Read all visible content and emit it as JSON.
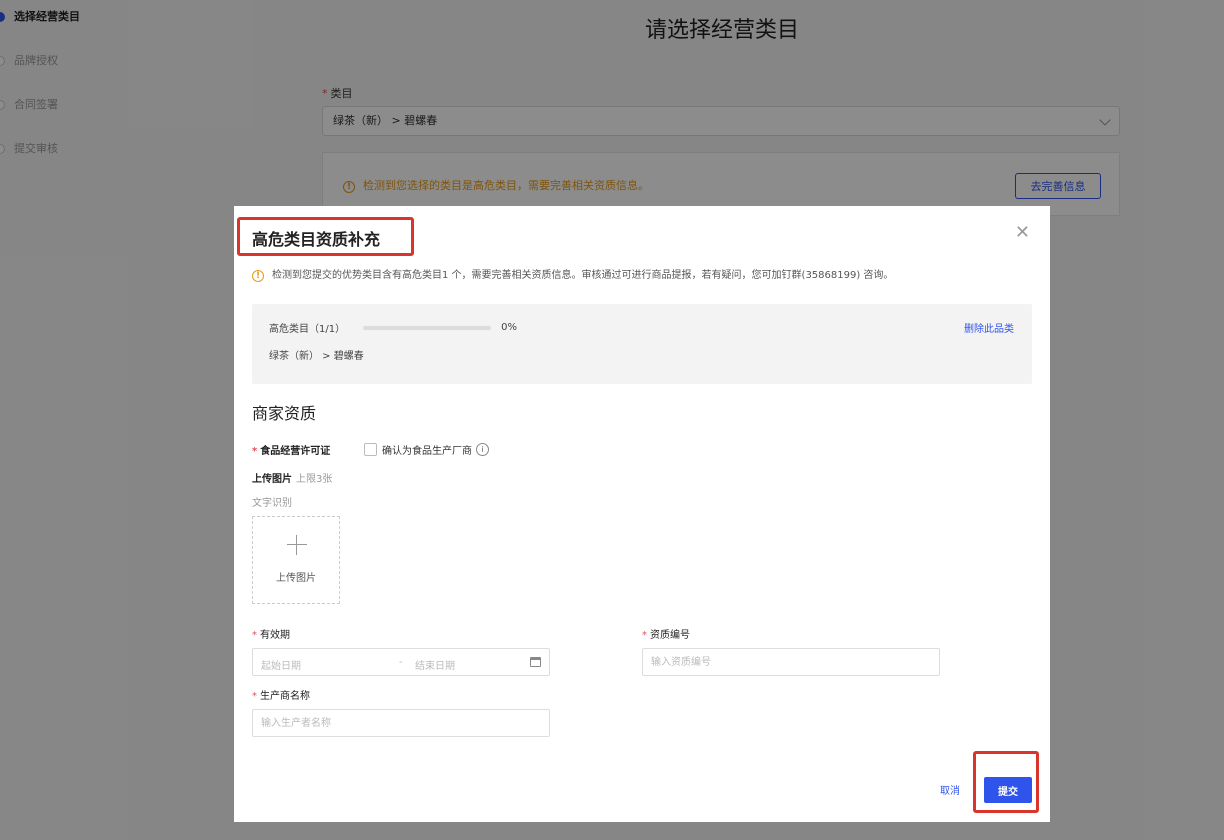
{
  "steps": [
    {
      "label": "选择经营类目",
      "active": true
    },
    {
      "label": "品牌授权",
      "active": false
    },
    {
      "label": "合同签署",
      "active": false
    },
    {
      "label": "提交审核",
      "active": false
    }
  ],
  "page": {
    "title": "请选择经营类目",
    "category_label": "类目",
    "category_value": "绿茶（新） > 碧螺春",
    "warning": "检测到您选择的类目是高危类目，需要完善相关资质信息。",
    "complete_button": "去完善信息"
  },
  "modal": {
    "title": "高危类目资质补充",
    "warning": "检测到您提交的优势类目含有高危类目1 个，需要完善相关资质信息。审核通过可进行商品提报，若有疑问，您可加钉群(35868199) 咨询。",
    "category_count": "高危类目（1/1）",
    "progress_percent": 0,
    "progress_text": "0%",
    "category_path": "绿茶（新） > 碧螺春",
    "delete_link": "删除此品类",
    "section_title": "商家资质",
    "license_label": "食品经营许可证",
    "checkbox_label": "确认为食品生产厂商",
    "upload_label": "上传图片",
    "upload_limit": "上限3张",
    "ocr_label": "文字识别",
    "upload_button": "上传图片",
    "validity_label": "有效期",
    "start_date_placeholder": "起始日期",
    "date_separator": "-",
    "end_date_placeholder": "结束日期",
    "cert_no_label": "资质编号",
    "cert_no_placeholder": "输入资质编号",
    "manufacturer_label": "生产商名称",
    "manufacturer_placeholder": "输入生产者名称",
    "cancel": "取消",
    "submit": "提交",
    "close_icon": "close-icon"
  },
  "colors": {
    "primary": "#2f54eb",
    "warning": "#e69a1a",
    "required": "#e34d59",
    "highlight": "#d9352c"
  }
}
